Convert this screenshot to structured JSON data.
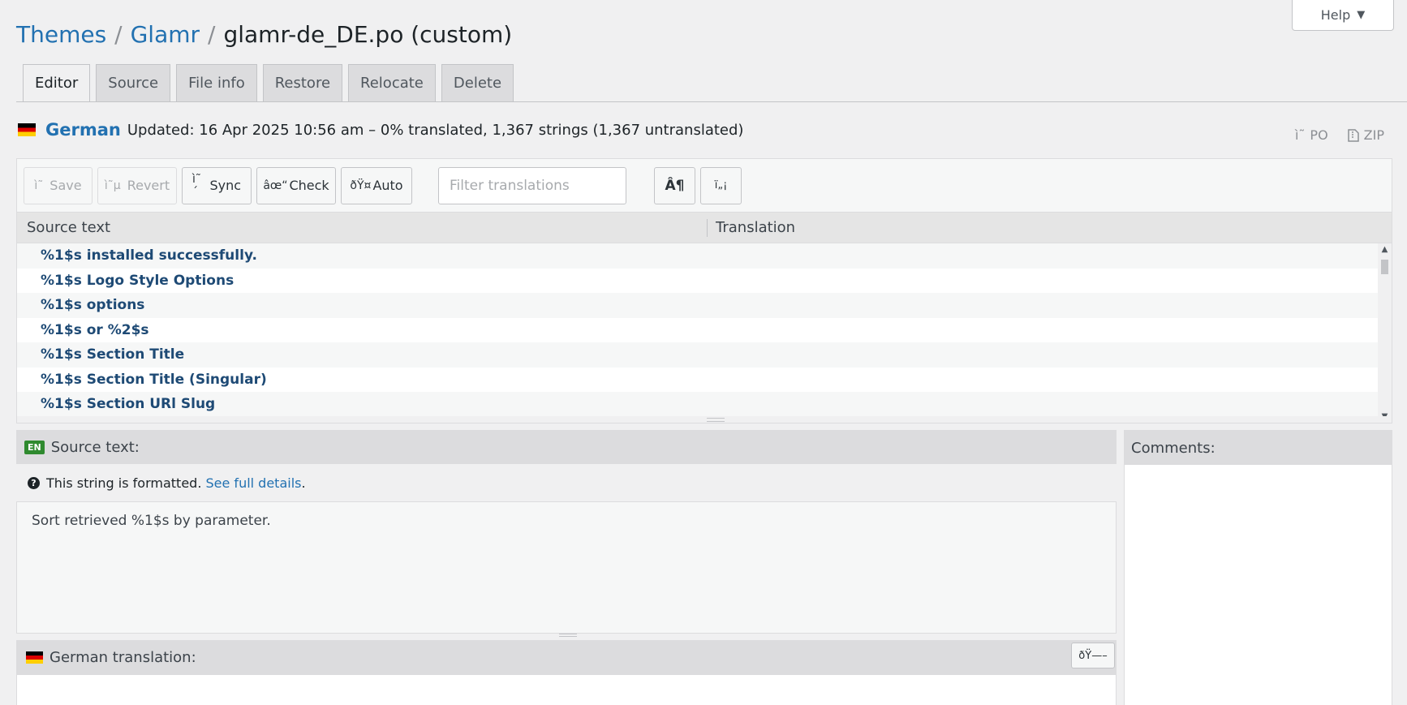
{
  "help": {
    "label": "Help",
    "caret": "▼"
  },
  "breadcrumb": {
    "themes": "Themes",
    "sep": "/",
    "theme": "Glamr",
    "file": "glamr-de_DE.po (custom)"
  },
  "tabs": [
    {
      "label": "Editor"
    },
    {
      "label": "Source"
    },
    {
      "label": "File info"
    },
    {
      "label": "Restore"
    },
    {
      "label": "Relocate"
    },
    {
      "label": "Delete"
    }
  ],
  "language": {
    "name": "German",
    "meta": "Updated: 16 Apr 2025 10:56 am – 0% translated, 1,367 strings (1,367 untranslated)",
    "flag_colors": [
      "#000000",
      "#dd0000",
      "#ffce00"
    ]
  },
  "downloads": {
    "po": {
      "icon": "ì˜",
      "label": "PO"
    },
    "zip": {
      "icon": "file-zip-icon",
      "label": "ZIP"
    }
  },
  "toolbar": {
    "save": {
      "icon": "ì˜",
      "label": "Save"
    },
    "revert": {
      "icon": "ì˜µ",
      "label": "Revert"
    },
    "sync": {
      "icon": "ì˜´",
      "label": "Sync"
    },
    "check": {
      "icon": "âœ“",
      "label": "Check"
    },
    "auto": {
      "icon": "ðŸ¤",
      "label": "Auto"
    },
    "filter_placeholder": "Filter translations",
    "pilcrow": "Â¶",
    "code": "ï„¡"
  },
  "columns": {
    "source": "Source text",
    "translation": "Translation"
  },
  "rows": [
    "%1$s installed successfully.",
    "%1$s Logo Style Options",
    "%1$s options",
    "%1$s or %2$s",
    "%1$s Section Title",
    "%1$s Section Title (Singular)",
    "%1$s Section URl Slug"
  ],
  "source_section": {
    "badge": "EN",
    "title": "Source text:",
    "notice_icon": "?",
    "notice": "This string is formatted.",
    "notice_link": "See full details",
    "notice_end": ".",
    "text": "Sort retrieved %1$s by parameter."
  },
  "translation_section": {
    "title": "German translation:",
    "button": "ðŸ—–"
  },
  "comments": {
    "title": "Comments:"
  }
}
